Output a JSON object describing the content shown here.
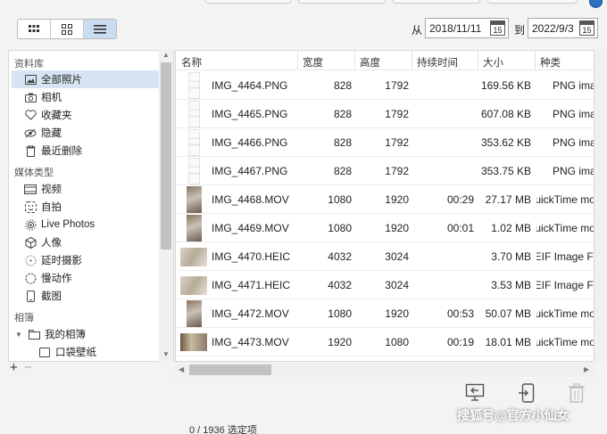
{
  "date_filter": {
    "from_label": "从",
    "from_value": "2018/11/11",
    "to_label": "到",
    "to_value": "2022/9/3",
    "calendar_day": "15"
  },
  "sidebar": {
    "library_header": "资料库",
    "library_items": [
      {
        "label": "全部照片",
        "icon": "photo-library-icon",
        "selected": true
      },
      {
        "label": "相机",
        "icon": "camera-icon"
      },
      {
        "label": "收藏夹",
        "icon": "heart-icon"
      },
      {
        "label": "隐藏",
        "icon": "eye-slash-icon"
      },
      {
        "label": "最近删除",
        "icon": "trash-icon"
      }
    ],
    "media_header": "媒体类型",
    "media_items": [
      {
        "label": "视频",
        "icon": "video-icon"
      },
      {
        "label": "自拍",
        "icon": "selfie-icon"
      },
      {
        "label": "Live Photos",
        "icon": "live-photo-icon"
      },
      {
        "label": "人像",
        "icon": "cube-icon"
      },
      {
        "label": "延时摄影",
        "icon": "timelapse-icon"
      },
      {
        "label": "慢动作",
        "icon": "slowmo-icon"
      },
      {
        "label": "截图",
        "icon": "phone-icon"
      }
    ],
    "albums_header": "相簿",
    "albums_items": [
      {
        "label": "我的相簿",
        "icon": "folder-icon"
      },
      {
        "label": "口袋壁纸",
        "icon": "album-icon"
      }
    ]
  },
  "table": {
    "columns": [
      "名称",
      "宽度",
      "高度",
      "持续时间",
      "大小",
      "种类"
    ],
    "rows": [
      {
        "name": "IMG_4464.PNG",
        "width": "828",
        "height": "1792",
        "duration": "",
        "size": "169.56 KB",
        "kind": "PNG image",
        "thumb": "screenshot"
      },
      {
        "name": "IMG_4465.PNG",
        "width": "828",
        "height": "1792",
        "duration": "",
        "size": "607.08 KB",
        "kind": "PNG image",
        "thumb": "screenshot"
      },
      {
        "name": "IMG_4466.PNG",
        "width": "828",
        "height": "1792",
        "duration": "",
        "size": "353.62 KB",
        "kind": "PNG image",
        "thumb": "screenshot"
      },
      {
        "name": "IMG_4467.PNG",
        "width": "828",
        "height": "1792",
        "duration": "",
        "size": "353.75 KB",
        "kind": "PNG image",
        "thumb": "screenshot"
      },
      {
        "name": "IMG_4468.MOV",
        "width": "1080",
        "height": "1920",
        "duration": "00:29",
        "size": "27.17 MB",
        "kind": "QuickTime movie",
        "thumb": "video"
      },
      {
        "name": "IMG_4469.MOV",
        "width": "1080",
        "height": "1920",
        "duration": "00:01",
        "size": "1.02 MB",
        "kind": "QuickTime movie",
        "thumb": "video"
      },
      {
        "name": "IMG_4470.HEIC",
        "width": "4032",
        "height": "3024",
        "duration": "",
        "size": "3.70 MB",
        "kind": "HEIF Image File Format",
        "thumb": "photo"
      },
      {
        "name": "IMG_4471.HEIC",
        "width": "4032",
        "height": "3024",
        "duration": "",
        "size": "3.53 MB",
        "kind": "HEIF Image File Format",
        "thumb": "photo"
      },
      {
        "name": "IMG_4472.MOV",
        "width": "1080",
        "height": "1920",
        "duration": "00:53",
        "size": "50.07 MB",
        "kind": "QuickTime movie",
        "thumb": "video"
      },
      {
        "name": "IMG_4473.MOV",
        "width": "1920",
        "height": "1080",
        "duration": "00:19",
        "size": "18.01 MB",
        "kind": "QuickTime movie",
        "thumb": "video-landscape"
      }
    ]
  },
  "status": {
    "selection_text": "0 / 1936 选定项"
  },
  "watermark": "搜狐号@官方小仙女",
  "colors": {
    "selection_bg": "#d6e4f3",
    "view_active_bg": "#c9dcf2"
  }
}
